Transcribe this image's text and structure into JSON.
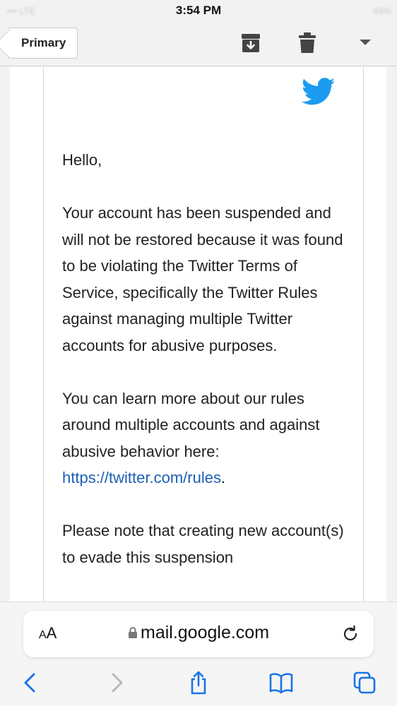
{
  "status_bar": {
    "time": "3:54 PM",
    "left_blurred": "••• LTE",
    "right_blurred": "49%"
  },
  "toolbar": {
    "back_label": "Primary",
    "archive_icon": "archive-icon",
    "trash_icon": "trash-icon",
    "more_icon": "chevron-down-icon"
  },
  "email": {
    "sender_logo": "twitter-bird-icon",
    "greeting": "Hello,",
    "paragraph1": "Your account has been suspended and will not be restored because it was found to be violating the Twitter Terms of Service, specifically the Twitter Rules against managing multiple Twitter accounts for abusive purposes.",
    "paragraph2_text": "You can learn more about our rules around multiple accounts and against abusive behavior here: ",
    "paragraph2_link": "https://twitter.com/rules",
    "paragraph2_end": ".",
    "paragraph3": "Please note that creating new account(s) to evade this suspension"
  },
  "safari": {
    "aa_large": "A",
    "aa_small": "A",
    "url": "mail.google.com",
    "colors": {
      "link": "#1a5fb4",
      "nav_active": "#1a73e8",
      "twitter": "#1d9bf0"
    }
  }
}
